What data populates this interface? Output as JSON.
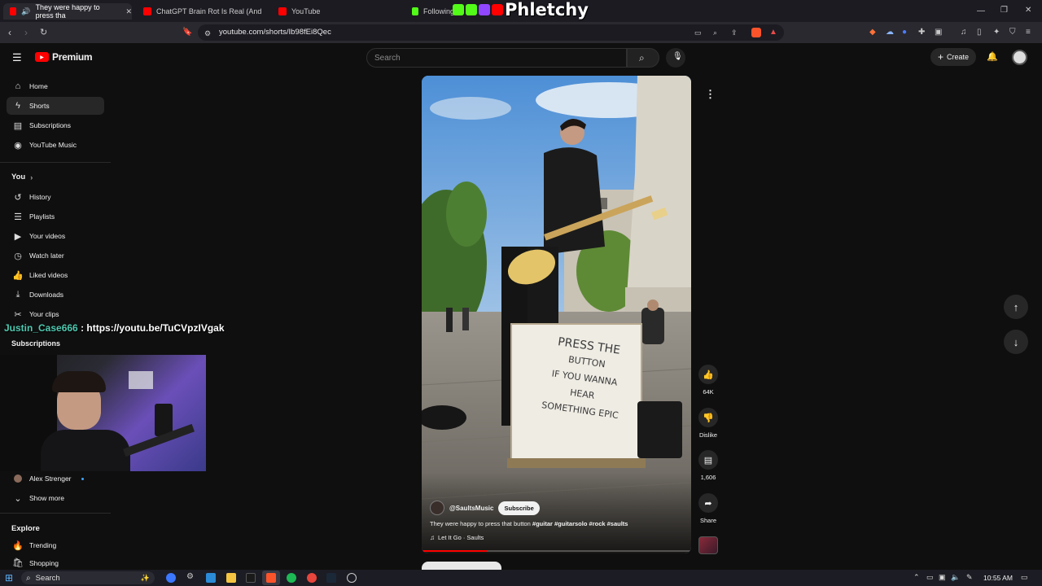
{
  "tabs": [
    {
      "title": "They were happy to press tha",
      "active": true
    },
    {
      "title": "ChatGPT Brain Rot Is Real (And Gettin",
      "active": false
    },
    {
      "title": "YouTube",
      "active": false
    },
    {
      "title": "Following",
      "active": false
    }
  ],
  "overlay_logo": "Phletchy",
  "address": {
    "url": "youtube.com/shorts/Ib98fEi8Qec"
  },
  "youtube": {
    "brand": "Premium",
    "search_placeholder": "Search",
    "create_label": "Create"
  },
  "sidebar": {
    "main": [
      {
        "label": "Home",
        "icon": "home-icon"
      },
      {
        "label": "Shorts",
        "icon": "shorts-icon",
        "active": true
      },
      {
        "label": "Subscriptions",
        "icon": "subscriptions-icon"
      },
      {
        "label": "YouTube Music",
        "icon": "music-icon"
      }
    ],
    "you_heading": "You",
    "you_items": [
      {
        "label": "History",
        "icon": "history-icon"
      },
      {
        "label": "Playlists",
        "icon": "playlist-icon"
      },
      {
        "label": "Your videos",
        "icon": "video-icon"
      },
      {
        "label": "Watch later",
        "icon": "clock-icon"
      },
      {
        "label": "Liked videos",
        "icon": "thumbs-up-icon"
      },
      {
        "label": "Downloads",
        "icon": "download-icon"
      },
      {
        "label": "Your clips",
        "icon": "scissors-icon"
      }
    ],
    "subscriptions_heading": "Subscriptions",
    "subscription_channel": "Alex Strenger",
    "show_more": "Show more",
    "explore_heading": "Explore",
    "explore_items": [
      {
        "label": "Trending",
        "icon": "trending-icon"
      },
      {
        "label": "Shopping",
        "icon": "shopping-icon"
      }
    ]
  },
  "chat_message": {
    "user": "Justin_Case666",
    "text": " : https://youtu.be/TuCVpzIVgak"
  },
  "short": {
    "sign_text": [
      "PRESS THE",
      "BUTTON",
      "IF YOU WANNA",
      "HEAR",
      "SOMETHING EPIC"
    ],
    "channel": "@SaultsMusic",
    "subscribe_label": "Subscribe",
    "title": "They were happy to press that button",
    "hashtags": "#guitar #guitarsolo #rock #saults",
    "song": "Let It Go · Saults",
    "likes": "64K",
    "dislike_label": "Dislike",
    "comments": "1,606",
    "share_label": "Share"
  },
  "taskbar": {
    "search_placeholder": "Search",
    "time": "10:55 AM"
  },
  "colors": {
    "brand_red": "#ff0000",
    "chat_user": "#4ec9b0"
  }
}
